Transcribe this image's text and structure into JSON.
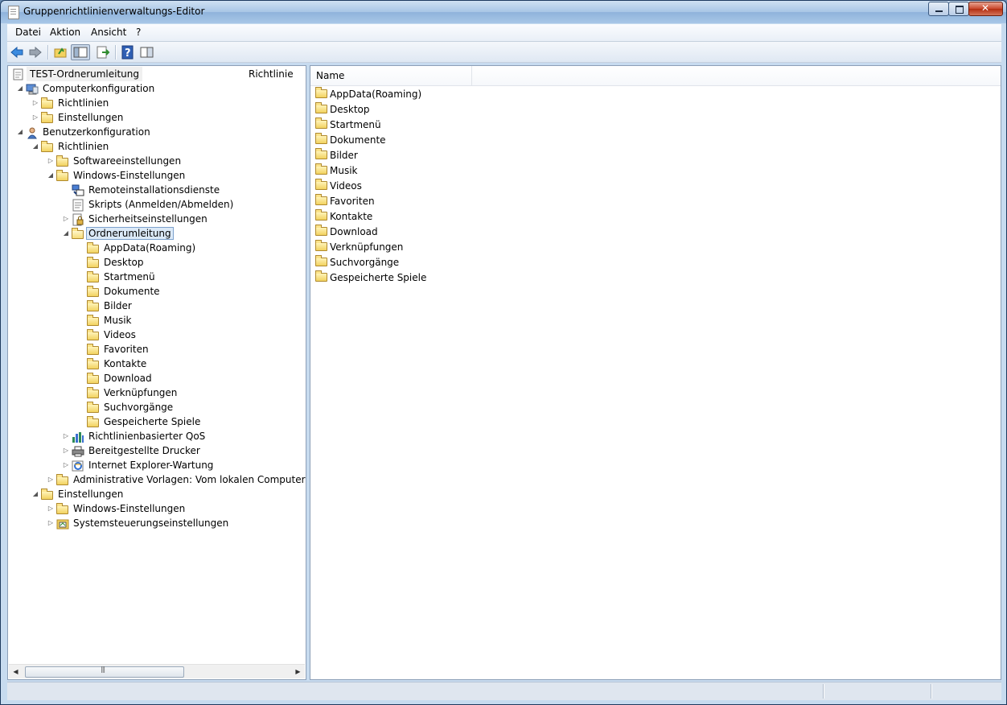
{
  "window": {
    "title": "Gruppenrichtlinienverwaltungs-Editor"
  },
  "menubar": {
    "items": [
      {
        "label": "Datei"
      },
      {
        "label": "Aktion"
      },
      {
        "label": "Ansicht"
      },
      {
        "label": "?"
      }
    ]
  },
  "toolbar": {
    "buttons": [
      {
        "icon": "back-arrow-icon"
      },
      {
        "icon": "forward-arrow-icon"
      },
      {
        "icon": "up-folder-icon"
      },
      {
        "icon": "show-hide-tree-icon"
      },
      {
        "icon": "export-list-icon"
      },
      {
        "icon": "help-icon"
      },
      {
        "icon": "properties-pane-icon"
      }
    ]
  },
  "tree": {
    "root": {
      "label": "TEST-Ordnerumleitung",
      "column_header": "Richtlinie"
    },
    "nodes": [
      {
        "label": "Computerkonfiguration",
        "icon": "computer-icon",
        "expander": "expanded"
      },
      {
        "label": "Richtlinien",
        "icon": "folder-icon",
        "expander": "collapsed"
      },
      {
        "label": "Einstellungen",
        "icon": "folder-icon",
        "expander": "collapsed"
      },
      {
        "label": "Benutzerkonfiguration",
        "icon": "user-icon",
        "expander": "expanded"
      },
      {
        "label": "Richtlinien",
        "icon": "folder-icon",
        "expander": "expanded"
      },
      {
        "label": "Softwareeinstellungen",
        "icon": "folder-icon",
        "expander": "collapsed"
      },
      {
        "label": "Windows-Einstellungen",
        "icon": "folder-icon",
        "expander": "expanded"
      },
      {
        "label": "Remoteinstallationsdienste",
        "icon": "remote-install-icon",
        "expander": "none"
      },
      {
        "label": "Skripts (Anmelden/Abmelden)",
        "icon": "script-icon",
        "expander": "none"
      },
      {
        "label": "Sicherheitseinstellungen",
        "icon": "security-icon",
        "expander": "collapsed"
      },
      {
        "label": "Ordnerumleitung",
        "icon": "open-folder-icon",
        "expander": "expanded",
        "selected": true
      },
      {
        "label": "AppData(Roaming)",
        "icon": "folder-icon",
        "expander": "none"
      },
      {
        "label": "Desktop",
        "icon": "folder-icon",
        "expander": "none"
      },
      {
        "label": "Startmenü",
        "icon": "folder-icon",
        "expander": "none"
      },
      {
        "label": "Dokumente",
        "icon": "folder-icon",
        "expander": "none"
      },
      {
        "label": "Bilder",
        "icon": "folder-icon",
        "expander": "none"
      },
      {
        "label": "Musik",
        "icon": "folder-icon",
        "expander": "none"
      },
      {
        "label": "Videos",
        "icon": "folder-icon",
        "expander": "none"
      },
      {
        "label": "Favoriten",
        "icon": "folder-icon",
        "expander": "none"
      },
      {
        "label": "Kontakte",
        "icon": "folder-icon",
        "expander": "none"
      },
      {
        "label": "Download",
        "icon": "folder-icon",
        "expander": "none"
      },
      {
        "label": "Verknüpfungen",
        "icon": "folder-icon",
        "expander": "none"
      },
      {
        "label": "Suchvorgänge",
        "icon": "folder-icon",
        "expander": "none"
      },
      {
        "label": "Gespeicherte Spiele",
        "icon": "folder-icon",
        "expander": "none"
      },
      {
        "label": "Richtlinienbasierter QoS",
        "icon": "qos-chart-icon",
        "expander": "collapsed"
      },
      {
        "label": "Bereitgestellte Drucker",
        "icon": "printer-icon",
        "expander": "collapsed"
      },
      {
        "label": "Internet Explorer-Wartung",
        "icon": "ie-maintenance-icon",
        "expander": "collapsed"
      },
      {
        "label": "Administrative Vorlagen: Vom lokalen Computer abger",
        "icon": "folder-icon",
        "expander": "collapsed"
      },
      {
        "label": "Einstellungen",
        "icon": "folder-icon",
        "expander": "expanded"
      },
      {
        "label": "Windows-Einstellungen",
        "icon": "folder-icon",
        "expander": "collapsed"
      },
      {
        "label": "Systemsteuerungseinstellungen",
        "icon": "control-panel-icon",
        "expander": "collapsed"
      }
    ]
  },
  "list": {
    "column_header": "Name",
    "items": [
      {
        "label": "AppData(Roaming)"
      },
      {
        "label": "Desktop"
      },
      {
        "label": "Startmenü"
      },
      {
        "label": "Dokumente"
      },
      {
        "label": "Bilder"
      },
      {
        "label": "Musik"
      },
      {
        "label": "Videos"
      },
      {
        "label": "Favoriten"
      },
      {
        "label": "Kontakte"
      },
      {
        "label": "Download"
      },
      {
        "label": "Verknüpfungen"
      },
      {
        "label": "Suchvorgänge"
      },
      {
        "label": "Gespeicherte Spiele"
      }
    ]
  },
  "colors": {
    "selection_bg": "#dbe9f7",
    "selection_border": "#7da2ce",
    "folder_fill": "#f2d25f"
  }
}
